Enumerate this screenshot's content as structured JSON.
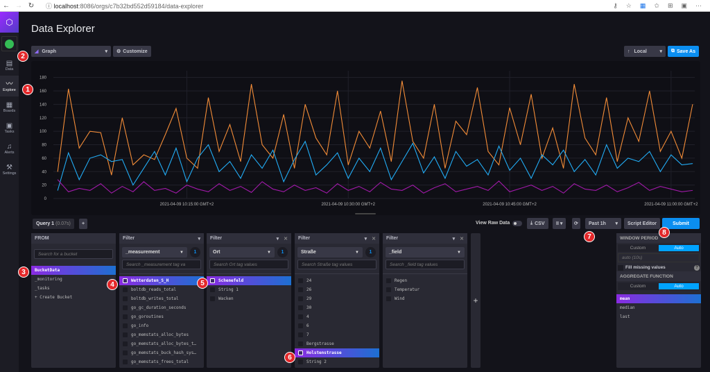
{
  "browser": {
    "url_host": "localhost",
    "url_rest": ":8086/orgs/c7b32bd552d59184/data-explorer"
  },
  "sidebar": {
    "items": [
      {
        "label": "Data",
        "icon": "database-icon",
        "glyph": "▤"
      },
      {
        "label": "Explore",
        "icon": "graph-icon",
        "glyph": "〰"
      },
      {
        "label": "Boards",
        "icon": "dashboard-icon",
        "glyph": "▦"
      },
      {
        "label": "Tasks",
        "icon": "calendar-icon",
        "glyph": "▣"
      },
      {
        "label": "Alerts",
        "icon": "bell-icon",
        "glyph": "♫"
      },
      {
        "label": "Settings",
        "icon": "wrench-icon",
        "glyph": "⚒"
      }
    ],
    "active": "Explore"
  },
  "header": {
    "title": "Data Explorer",
    "vis_type": "Graph",
    "customize": "Customize",
    "timezone": "Local",
    "save_as": "Save As"
  },
  "chart_data": {
    "type": "line",
    "ylim": [
      0,
      190
    ],
    "yticks": [
      0,
      20,
      40,
      60,
      80,
      100,
      120,
      140,
      160,
      180
    ],
    "xtick_labels": [
      "2021-04-09 10:15:00 GMT+2",
      "2021-04-09 10:30:00 GMT+2",
      "2021-04-09 10:45:00 GMT+2",
      "2021-04-09 11:00:00 GMT+2"
    ],
    "xtick_times": [
      "10:15",
      "10:30",
      "10:45",
      "11:00"
    ],
    "xlim": [
      "10:03",
      "11:02"
    ],
    "x": [
      "10:03",
      "10:04",
      "10:05",
      "10:06",
      "10:07",
      "10:08",
      "10:09",
      "10:10",
      "10:11",
      "10:12",
      "10:13",
      "10:14",
      "10:15",
      "10:16",
      "10:17",
      "10:18",
      "10:19",
      "10:20",
      "10:21",
      "10:22",
      "10:23",
      "10:24",
      "10:25",
      "10:26",
      "10:27",
      "10:28",
      "10:29",
      "10:30",
      "10:31",
      "10:32",
      "10:33",
      "10:34",
      "10:35",
      "10:36",
      "10:37",
      "10:38",
      "10:39",
      "10:40",
      "10:41",
      "10:42",
      "10:43",
      "10:44",
      "10:45",
      "10:46",
      "10:47",
      "10:48",
      "10:49",
      "10:50",
      "10:51",
      "10:52",
      "10:53",
      "10:54",
      "10:55",
      "10:56",
      "10:57",
      "10:58",
      "10:59",
      "11:00",
      "11:01",
      "11:02"
    ],
    "grid": true,
    "series": [
      {
        "color": "#f48d38",
        "values": [
          40,
          163,
          75,
          100,
          98,
          35,
          120,
          50,
          65,
          58,
          95,
          134,
          60,
          45,
          150,
          70,
          110,
          55,
          170,
          80,
          60,
          125,
          45,
          140,
          90,
          65,
          160,
          50,
          100,
          75,
          130,
          55,
          175,
          85,
          60,
          140,
          45,
          115,
          95,
          165,
          70,
          50,
          135,
          80,
          155,
          60,
          105,
          45,
          170,
          90,
          65,
          150,
          55,
          120,
          85,
          160,
          70,
          100,
          60,
          140
        ]
      },
      {
        "color": "#22adf6",
        "values": [
          12,
          68,
          28,
          60,
          65,
          55,
          58,
          20,
          45,
          70,
          35,
          75,
          25,
          60,
          80,
          40,
          55,
          30,
          65,
          45,
          72,
          25,
          58,
          85,
          35,
          50,
          68,
          30,
          60,
          40,
          75,
          28,
          55,
          82,
          38,
          62,
          30,
          70,
          48,
          58,
          35,
          78,
          42,
          60,
          30,
          65,
          50,
          72,
          40,
          58,
          35,
          80,
          45,
          60,
          55,
          70,
          40,
          65,
          50,
          52
        ]
      },
      {
        "color": "#a21aaa",
        "values": [
          28,
          10,
          15,
          12,
          22,
          8,
          18,
          10,
          25,
          12,
          15,
          8,
          20,
          14,
          10,
          22,
          12,
          18,
          9,
          25,
          14,
          10,
          20,
          12,
          16,
          8,
          22,
          12,
          18,
          10,
          24,
          14,
          12,
          20,
          8,
          16,
          22,
          10,
          14,
          18,
          12,
          26,
          10,
          15,
          20,
          12,
          18,
          8,
          22,
          14,
          12,
          20,
          10,
          16,
          24,
          12,
          18,
          14,
          10,
          12
        ]
      }
    ]
  },
  "query": {
    "tab": "Query 1",
    "time": "(0.07s)",
    "add": "+",
    "view_raw": "View Raw Data",
    "csv": "CSV",
    "pause": "II ▾",
    "range": "Past 1h",
    "script_editor": "Script Editor",
    "submit": "Submit"
  },
  "from": {
    "title": "FROM",
    "placeholder": "Search for a bucket",
    "items": [
      "BucketData",
      "_monitoring",
      "_tasks",
      "+ Create Bucket"
    ],
    "selected": 0
  },
  "filters": [
    {
      "title": "Filter",
      "key": "_measurement",
      "count": "1",
      "placeholder": "Search _measurement tag va",
      "items": [
        "Wetterdaten_S_H",
        "boltdb_reads_total",
        "boltdb_writes_total",
        "go_gc_duration_seconds",
        "go_goroutines",
        "go_info",
        "go_memstats_alloc_bytes",
        "go_memstats_alloc_bytes_t…",
        "go_memstats_buck_hash_sys…",
        "go_memstats_frees_total"
      ],
      "selected": 0
    },
    {
      "title": "Filter",
      "key": "Ort",
      "count": "1",
      "placeholder": "Search Ort tag values",
      "items": [
        "Schenefeld",
        "String 1",
        "Wacken"
      ],
      "selected": 0
    },
    {
      "title": "Filter",
      "key": "Straße",
      "count": "1",
      "placeholder": "Search Straße tag values",
      "items": [
        "24",
        "26",
        "29",
        "30",
        "4",
        "6",
        "7",
        "Bergstrasse",
        "Holstenstrasse",
        "String 2"
      ],
      "selected": 8
    },
    {
      "title": "Filter",
      "key": "_field",
      "count": "",
      "placeholder": "Search _field tag values",
      "items": [
        "Regen",
        "Temperatur",
        "Wind"
      ],
      "selected": -1
    }
  ],
  "window": {
    "title": "WINDOW PERIOD",
    "custom": "Custom",
    "auto": "Auto",
    "value": "auto (10s)",
    "fill": "Fill missing values",
    "help": "?"
  },
  "aggregate": {
    "title": "AGGREGATE FUNCTION",
    "custom": "Custom",
    "auto": "Auto",
    "items": [
      "mean",
      "median",
      "last"
    ],
    "selected": 0
  },
  "badges": [
    "1",
    "2",
    "3",
    "4",
    "5",
    "6",
    "7",
    "8"
  ]
}
